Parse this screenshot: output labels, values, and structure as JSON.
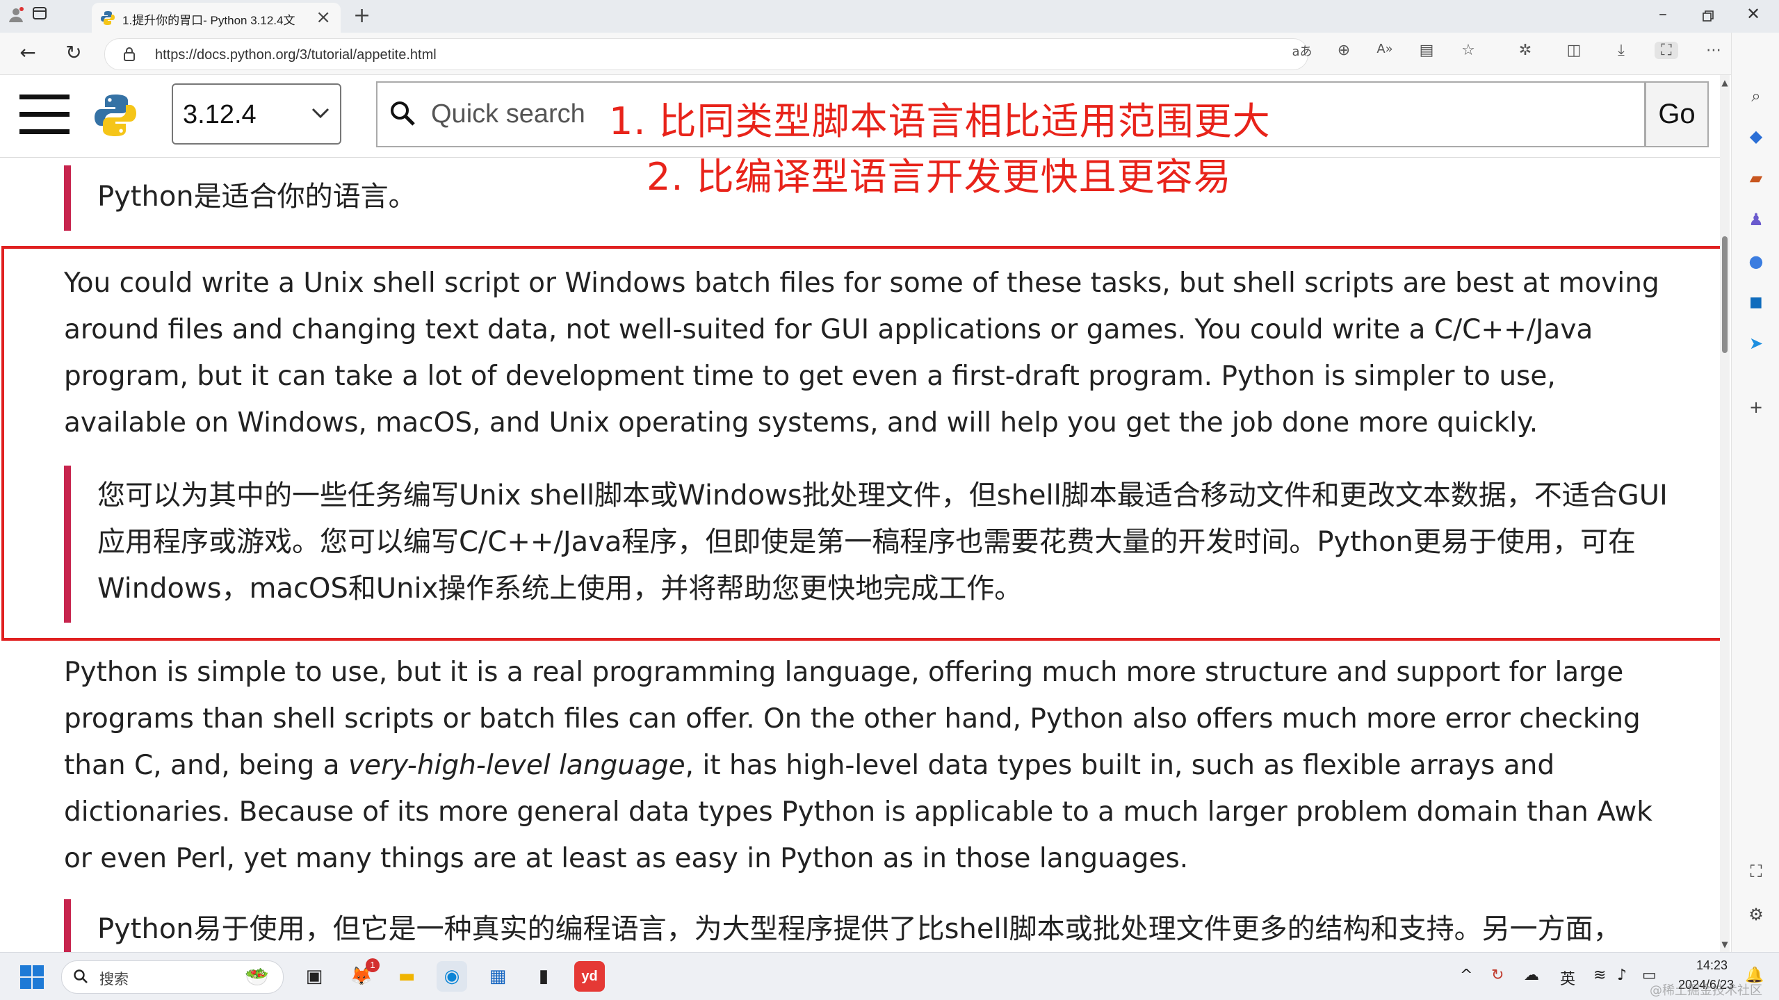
{
  "browser": {
    "tab_title": "1.提升你的胃口- Python 3.12.4文",
    "url": "https://docs.python.org/3/tutorial/appetite.html",
    "accent_color": "#c7254e"
  },
  "docs_header": {
    "version_value": "3.12.4",
    "search_placeholder": "Quick search",
    "go_label": "Go"
  },
  "annotations": {
    "line1": "1. 比同类型脚本语言相比适用范围更大",
    "line2": "2. 比编译型语言开发更快且更容易",
    "color": "#e8231a"
  },
  "content": {
    "blockquote_top": "Python是适合你的语言。",
    "paragraph_1": "You could write a Unix shell script or Windows batch files for some of these tasks, but shell scripts are best at moving around files and changing text data, not well-suited for GUI applications or games. You could write a C/C++/Java program, but it can take a lot of development time to get even a first-draft program. Python is simpler to use, available on Windows, macOS, and Unix operating systems, and will help you get the job done more quickly.",
    "blockquote_mid": "您可以为其中的一些任务编写Unix shell脚本或Windows批处理文件，但shell脚本最适合移动文件和更改文本数据，不适合GUI应用程序或游戏。您可以编写C/C++/Java程序，但即使是第一稿程序也需要花费大量的开发时间。Python更易于使用，可在Windows，macOS和Unix操作系统上使用，并将帮助您更快地完成工作。",
    "paragraph_2_before": "Python is simple to use, but it is a real programming language, offering much more structure and support for large programs than shell scripts or batch files can offer. On the other hand, Python also offers much more error checking than C, and, being a ",
    "paragraph_2_em": "very-high-level language",
    "paragraph_2_after": ", it has high-level data types built in, such as flexible arrays and dictionaries. Because of its more general data types Python is applicable to a much larger problem domain than Awk or even Perl, yet many things are at least as easy in Python as in those languages.",
    "blockquote_bottom": "Python易于使用，但它是一种真实的编程语言，为大型程序提供了比shell脚本或批处理文件更多的结构和支持。另一方面，"
  },
  "taskbar": {
    "search_label": "搜索",
    "ime_label": "英",
    "time": "14:23",
    "date": "2024/6/23",
    "notification_badge": "1",
    "youdao_label": "yd",
    "watermark": "@稀土掘金技术社区"
  }
}
